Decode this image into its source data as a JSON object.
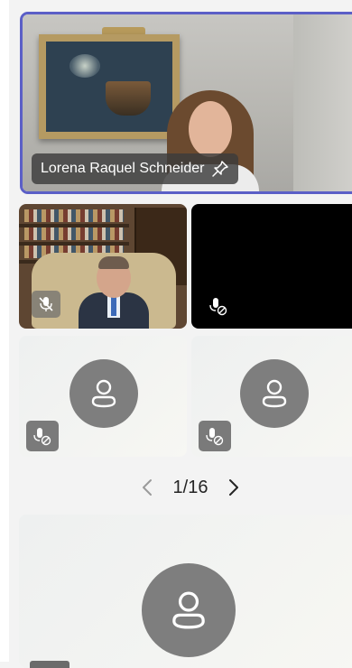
{
  "speaker": {
    "name": "Lorena Raquel Schneider",
    "icon": "pin-icon"
  },
  "tiles": [
    {
      "id": "man",
      "mic": "mic-off-icon"
    },
    {
      "id": "black",
      "mic": "mic-off-icon"
    },
    {
      "id": "avatar-1",
      "icon": "person-icon",
      "mic": "mic-off-icon"
    },
    {
      "id": "avatar-2",
      "icon": "person-icon",
      "mic": "mic-off-icon"
    },
    {
      "id": "avatar-3",
      "icon": "person-icon"
    }
  ],
  "pagination": {
    "page_label": "1/16",
    "prev_icon": "chevron-left-icon",
    "next_icon": "chevron-right-icon"
  },
  "colors": {
    "accent": "#5b5fc7",
    "avatar": "#7e7e7e",
    "background": "#f3f3f3"
  }
}
